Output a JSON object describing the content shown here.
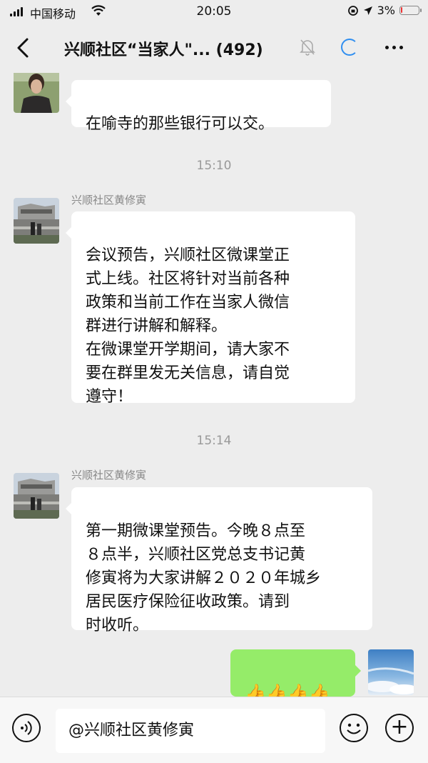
{
  "status_bar": {
    "carrier": "中国移动",
    "time": "20:05",
    "battery": "3%",
    "battery_level": 0.03,
    "icons": [
      "signal-icon",
      "wifi-icon",
      "orientation-lock-icon",
      "location-icon",
      "battery-icon"
    ]
  },
  "nav": {
    "title": "兴顺社区“当家人\"... (492)",
    "icons": [
      "back-chevron-icon",
      "muted-bell-icon",
      "loading-circle-icon",
      "more-dots-icon"
    ],
    "loading_color": "#2f8ef0"
  },
  "chat": {
    "messages": [
      {
        "type": "incoming",
        "sender": "",
        "text": "在喻寺的那些银行可以交。"
      },
      {
        "type": "timestamp",
        "text": "15:10"
      },
      {
        "type": "incoming",
        "sender": "兴顺社区黄修寅",
        "text": "会议预告，兴顺社区微课堂正\n式上线。社区将针对当前各种\n政策和当前工作在当家人微信\n群进行讲解和解释。\n在微课堂开学期间，请大家不\n要在群里发无关信息，请自觉\n遵守！"
      },
      {
        "type": "timestamp",
        "text": "15:14"
      },
      {
        "type": "incoming",
        "sender": "兴顺社区黄修寅",
        "text": "第一期微课堂预告。今晚８点至\n８点半，兴顺社区党总支书记黄\n修寅将为大家讲解２０２０年城乡\n居民医疗保险征收政策。请到\n时收听。"
      },
      {
        "type": "outgoing",
        "text": "👍👍👍👍"
      }
    ],
    "outgoing_bubble_color": "#95ec69"
  },
  "input_bar": {
    "value": "@兴顺社区黄修寅",
    "icons": [
      "voice-icon",
      "emoji-icon",
      "plus-icon"
    ]
  }
}
